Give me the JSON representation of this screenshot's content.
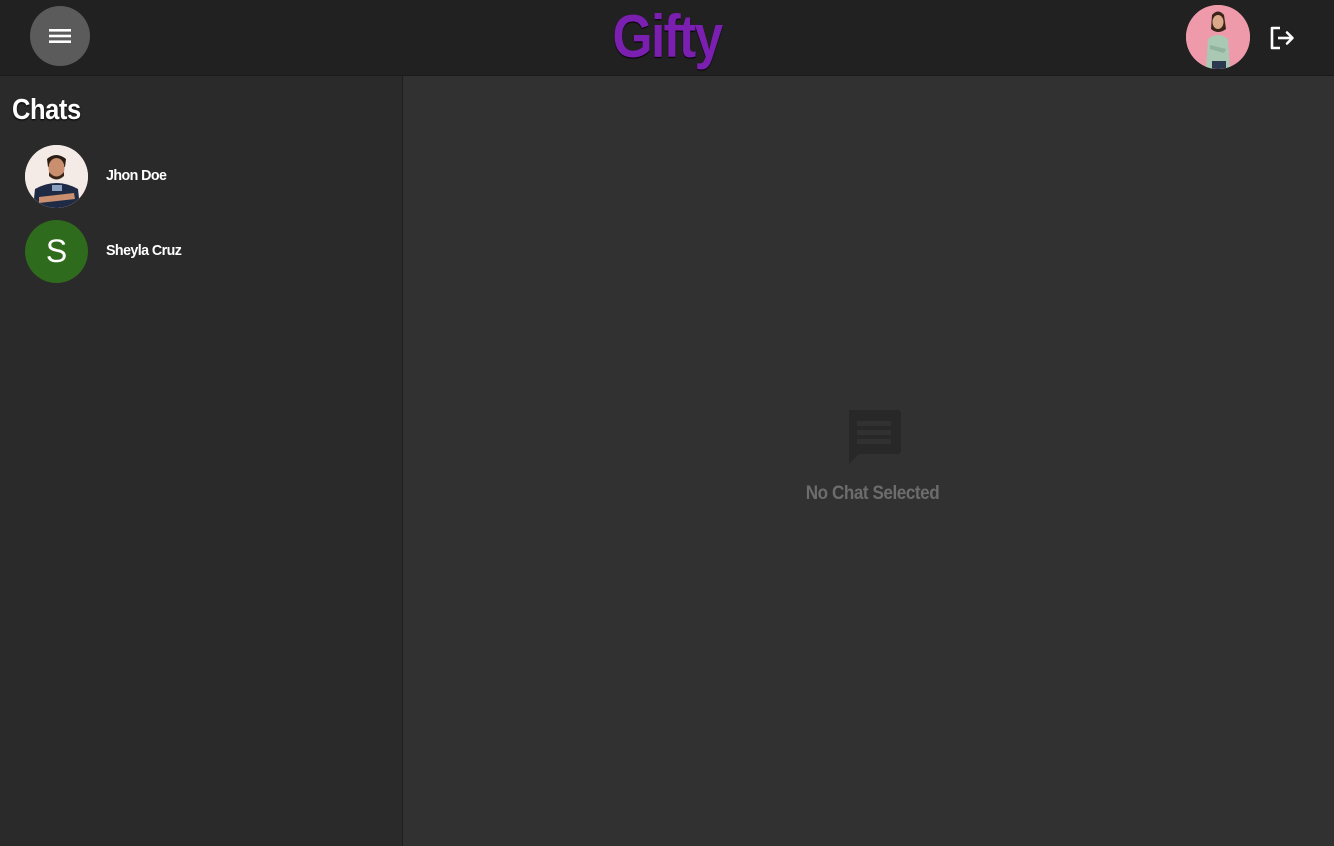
{
  "header": {
    "brand": "Gifty",
    "menu_icon": "hamburger-menu-icon",
    "logout_icon": "logout-icon",
    "brand_color": "#7a1fb0"
  },
  "sidebar": {
    "title": "Chats",
    "chats": [
      {
        "name": "Jhon Doe",
        "avatar": "photo"
      },
      {
        "name": "Sheyla Cruz",
        "avatar_letter": "S",
        "avatar_color": "#2f6b1c"
      }
    ]
  },
  "main": {
    "empty_icon": "chat-bubble-icon",
    "empty_text": "No Chat Selected"
  }
}
